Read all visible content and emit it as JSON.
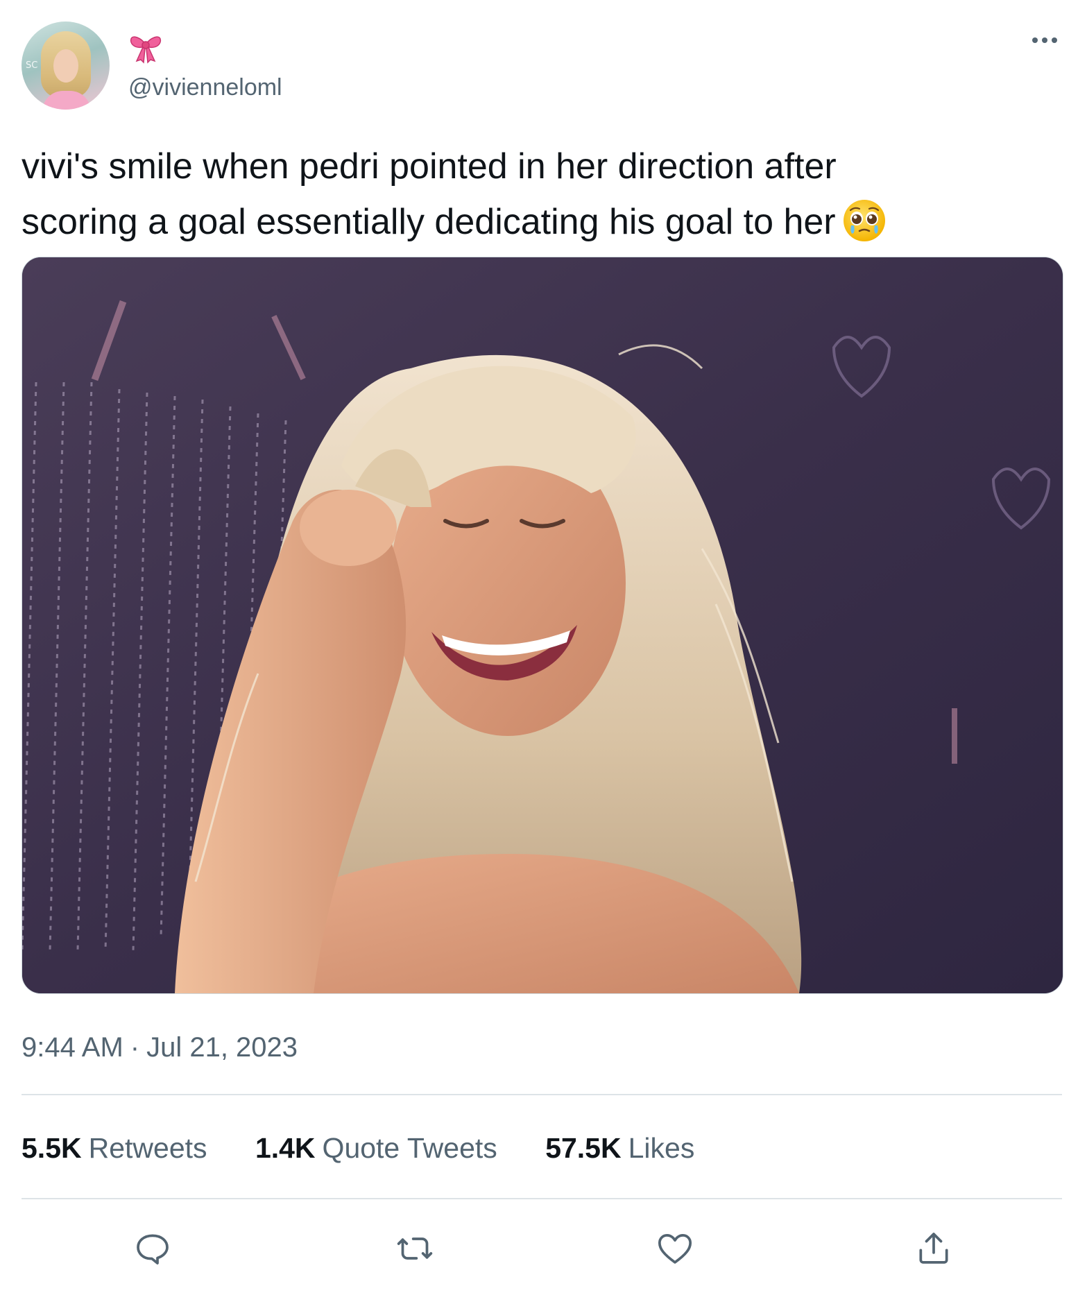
{
  "author": {
    "handle": "@vivienneloml",
    "display_name_icon": "ribbon-bow-emoji",
    "avatar_badge": "SC"
  },
  "tweet": {
    "text_line_1": "vivi's smile when pedri pointed in her direction after",
    "text_line_2": "scoring a goal essentially dedicating his goal to her",
    "trailing_emoji": "pleading-face-with-tears-emoji"
  },
  "media": {
    "kind": "photo",
    "icon": "photo"
  },
  "meta": {
    "time": "9:44 AM",
    "separator": "·",
    "date": "Jul 21, 2023"
  },
  "stats": {
    "retweets_count": "5.5K",
    "retweets_label": "Retweets",
    "quotes_count": "1.4K",
    "quotes_label": "Quote Tweets",
    "likes_count": "57.5K",
    "likes_label": "Likes"
  },
  "actions": {
    "reply_icon": "reply-icon",
    "retweet_icon": "retweet-icon",
    "like_icon": "heart-icon",
    "share_icon": "share-icon"
  },
  "colors": {
    "text_primary": "#0f1419",
    "text_secondary": "#536471",
    "divider": "#dde3e7",
    "bow_pink": "#f0609b"
  }
}
